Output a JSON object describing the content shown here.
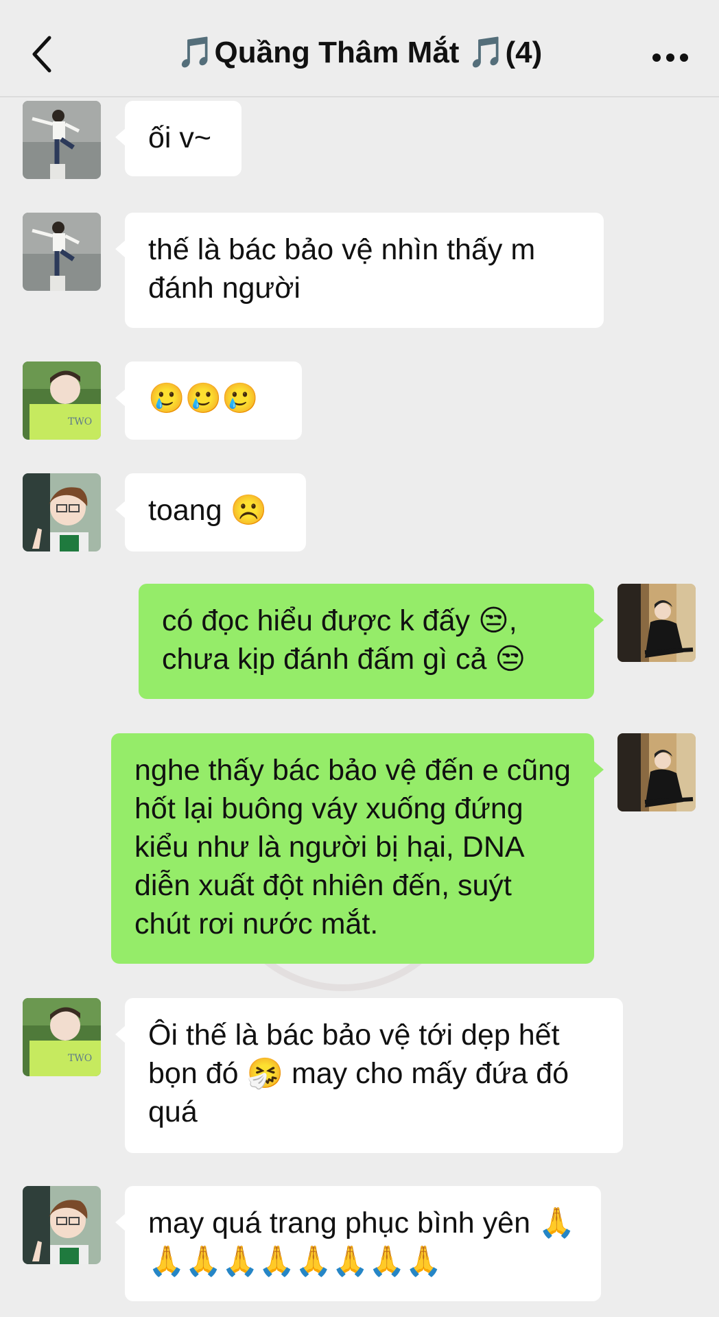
{
  "header": {
    "title": "🎵Quầng Thâm Mắt 🎵(4)"
  },
  "messages": [
    {
      "sender": "friend-1",
      "side": "in",
      "text": "ối v~"
    },
    {
      "sender": "friend-1",
      "side": "in",
      "text": "thế là bác bảo vệ nhìn thấy m đánh người"
    },
    {
      "sender": "friend-2",
      "side": "in",
      "text": "🥲🥲🥲"
    },
    {
      "sender": "friend-3",
      "side": "in",
      "text": "toang ☹️"
    },
    {
      "sender": "me",
      "side": "out",
      "text": "có đọc hiểu được k đấy 😒, chưa kịp đánh đấm gì cả 😒"
    },
    {
      "sender": "me",
      "side": "out",
      "text": "nghe thấy bác bảo vệ đến e cũng hốt lại buông váy xuống đứng kiểu như là người bị hại, DNA diễn xuất đột nhiên đến, suýt chút rơi nước mắt."
    },
    {
      "sender": "friend-2",
      "side": "in",
      "text": "Ôi thế là bác bảo vệ tới dẹp hết bọn đó 🤧 may cho mấy đứa đó quá"
    },
    {
      "sender": "friend-3",
      "side": "in",
      "text": "may quá trang phục bình yên 🙏🙏🙏🙏🙏🙏🙏🙏🙏"
    }
  ],
  "icons": {
    "back": "chevron-left-icon",
    "more": "more-horizontal-icon"
  },
  "colors": {
    "background": "#ededed",
    "incoming_bubble": "#ffffff",
    "outgoing_bubble": "#95ec69"
  }
}
